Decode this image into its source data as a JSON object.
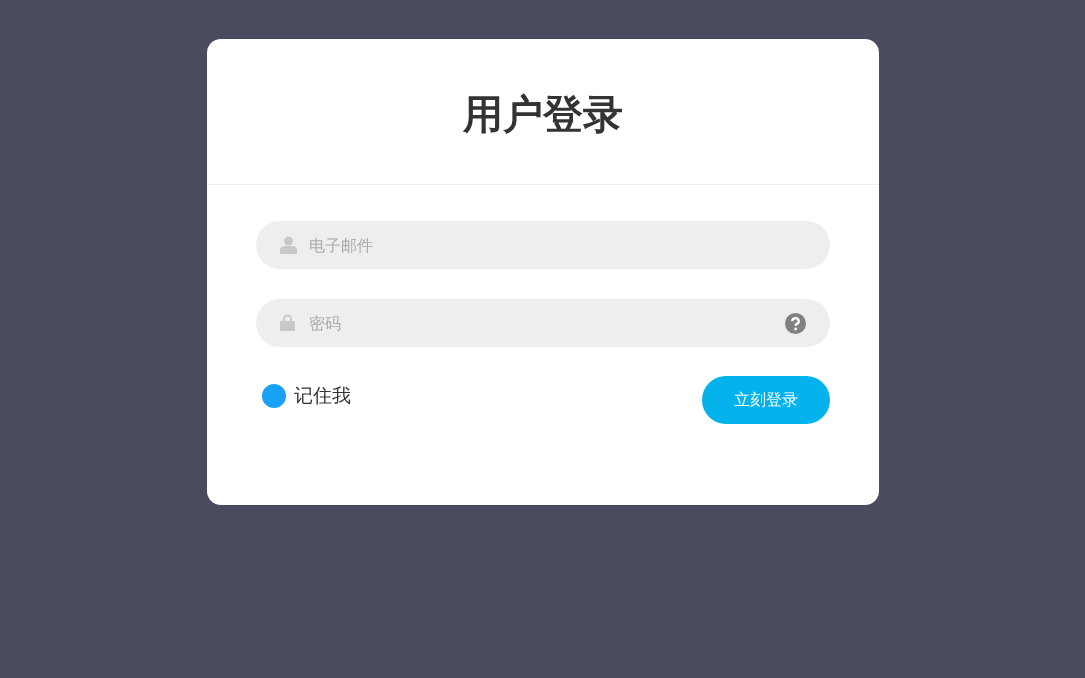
{
  "title": "用户登录",
  "email": {
    "placeholder": "电子邮件"
  },
  "password": {
    "placeholder": "密码"
  },
  "remember": {
    "label": "记住我",
    "checked": true
  },
  "submit": {
    "label": "立刻登录"
  }
}
